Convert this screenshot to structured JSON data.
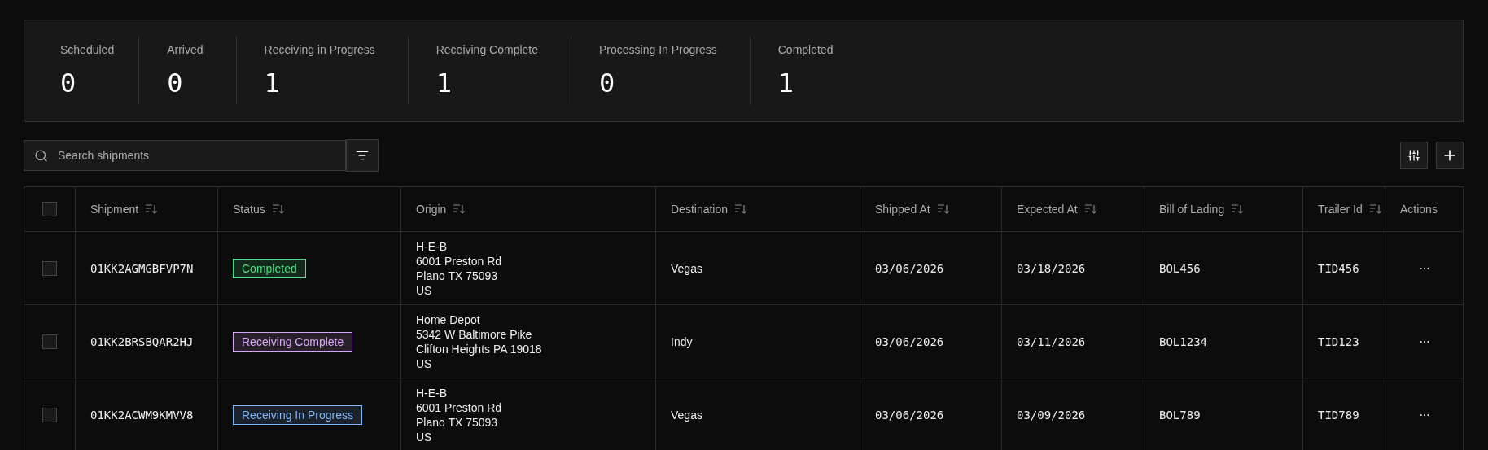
{
  "stats": [
    {
      "label": "Scheduled",
      "value": "0"
    },
    {
      "label": "Arrived",
      "value": "0"
    },
    {
      "label": "Receiving in Progress",
      "value": "1"
    },
    {
      "label": "Receiving Complete",
      "value": "1"
    },
    {
      "label": "Processing In Progress",
      "value": "0"
    },
    {
      "label": "Completed",
      "value": "1"
    }
  ],
  "search": {
    "placeholder": "Search shipments"
  },
  "table": {
    "select_all": {
      "checked": false
    },
    "columns": [
      {
        "label": "Shipment",
        "sortable": true
      },
      {
        "label": "Status",
        "sortable": true
      },
      {
        "label": "Origin",
        "sortable": true
      },
      {
        "label": "Destination",
        "sortable": true
      },
      {
        "label": "Shipped At",
        "sortable": true
      },
      {
        "label": "Expected At",
        "sortable": true
      },
      {
        "label": "Bill of Lading",
        "sortable": true
      },
      {
        "label": "Trailer Id",
        "sortable": true
      },
      {
        "label": "Actions",
        "sortable": false
      }
    ],
    "rows": [
      {
        "checked": false,
        "shipment": "01KK2AGMGBFVP7N",
        "status": {
          "label": "Completed",
          "color": "#4ade80"
        },
        "origin": [
          "H-E-B",
          "6001 Preston Rd",
          "Plano TX 75093",
          "US"
        ],
        "destination": "Vegas",
        "shipped_at": "03/06/2026",
        "expected_at": "03/18/2026",
        "bill_of_lading": "BOL456",
        "trailer_id": "TID456",
        "actions": "···"
      },
      {
        "checked": false,
        "shipment": "01KK2BRSBQAR2HJ",
        "status": {
          "label": "Receiving Complete",
          "color": "#d8a4f5"
        },
        "origin": [
          "Home Depot",
          "5342 W Baltimore Pike",
          "Clifton Heights PA 19018",
          "US"
        ],
        "destination": "Indy",
        "shipped_at": "03/06/2026",
        "expected_at": "03/11/2026",
        "bill_of_lading": "BOL1234",
        "trailer_id": "TID123",
        "actions": "···"
      },
      {
        "checked": false,
        "shipment": "01KK2ACWM9KMVV8",
        "status": {
          "label": "Receiving In Progress",
          "color": "#7cb4f8"
        },
        "origin": [
          "H-E-B",
          "6001 Preston Rd",
          "Plano TX 75093",
          "US"
        ],
        "destination": "Vegas",
        "shipped_at": "03/06/2026",
        "expected_at": "03/09/2026",
        "bill_of_lading": "BOL789",
        "trailer_id": "TID789",
        "actions": "···"
      }
    ]
  }
}
